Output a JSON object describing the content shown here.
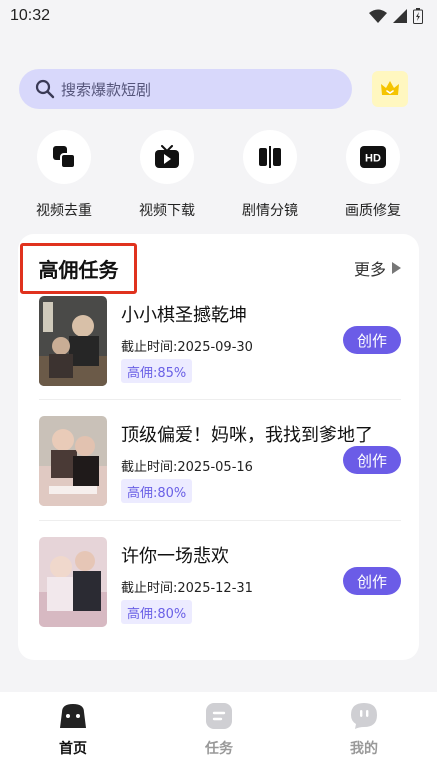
{
  "status_bar": {
    "time": "10:32"
  },
  "search": {
    "placeholder": "搜索爆款短剧"
  },
  "tools": [
    {
      "label": "视频去重",
      "icon": "dedupe-icon"
    },
    {
      "label": "视频下载",
      "icon": "tv-download-icon"
    },
    {
      "label": "剧情分镜",
      "icon": "storyboard-icon"
    },
    {
      "label": "画质修复",
      "icon": "hd-icon"
    }
  ],
  "task_section": {
    "title": "高佣任务",
    "more_label": "更多",
    "items": [
      {
        "name": "小小棋圣撼乾坤",
        "deadline": "截止时间:2025-09-30",
        "rate": "高佣:85%",
        "button": "创作"
      },
      {
        "name": "顶级偏爱！妈咪，我找到爹地了",
        "deadline": "截止时间:2025-05-16",
        "rate": "高佣:80%",
        "button": "创作"
      },
      {
        "name": "许你一场悲欢",
        "deadline": "截止时间:2025-12-31",
        "rate": "高佣:80%",
        "button": "创作"
      }
    ]
  },
  "bottom_nav": [
    {
      "label": "首页",
      "active": true
    },
    {
      "label": "任务",
      "active": false
    },
    {
      "label": "我的",
      "active": false
    }
  ],
  "colors": {
    "accent": "#6b5ce7",
    "search_bg": "#d8d8fb",
    "highlight_border": "#e0321e"
  }
}
